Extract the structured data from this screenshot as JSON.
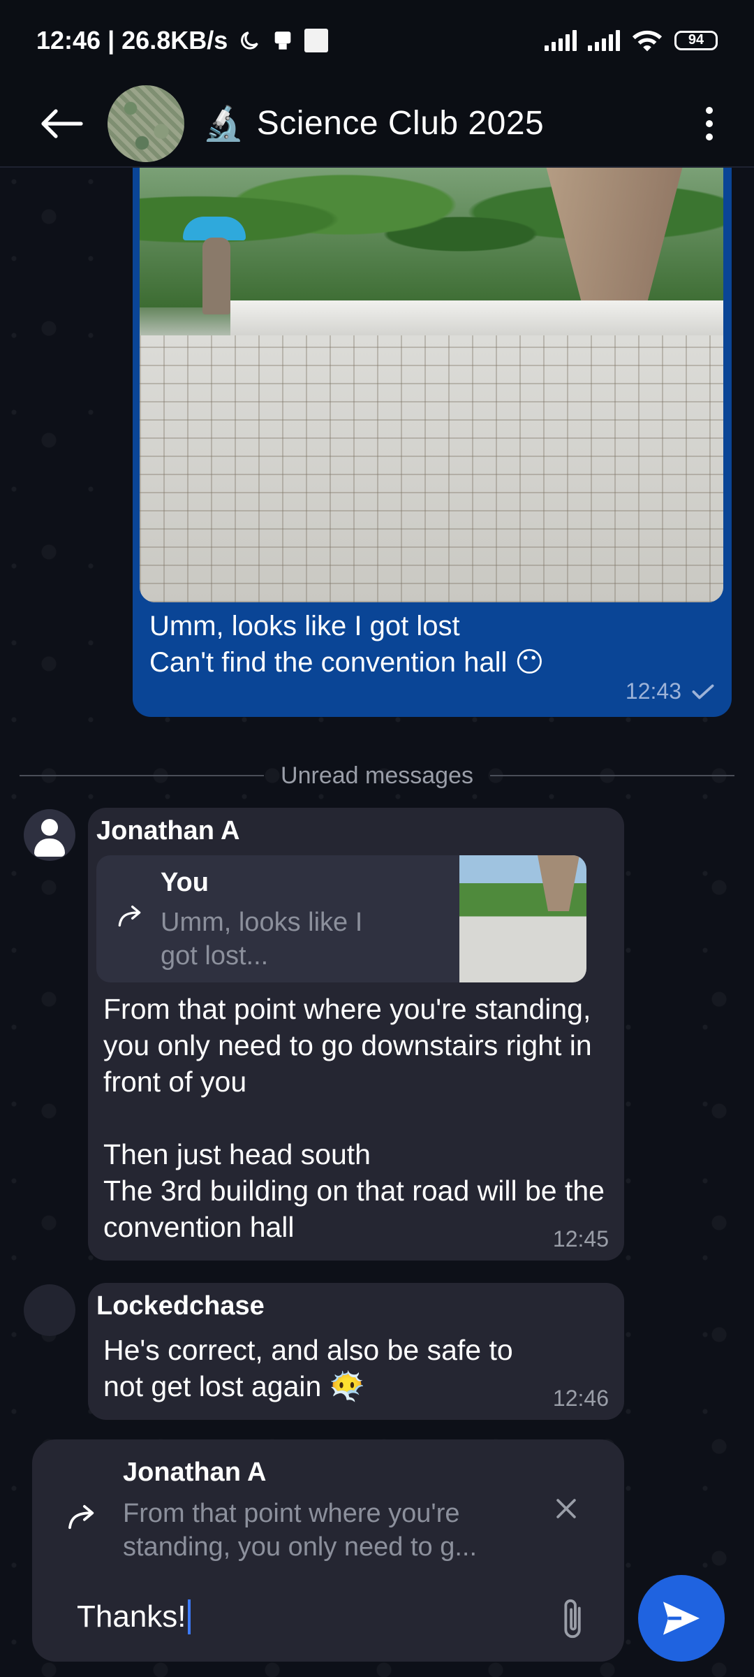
{
  "status_bar": {
    "left_text": "12:46 | 26.8KB/s",
    "battery": "94"
  },
  "header": {
    "group_emoji": "🔬",
    "title": "Science Club 2025"
  },
  "own_message": {
    "lines": [
      "Umm, looks like I got lost",
      "Can't find the convention hall 😶"
    ],
    "time": "12:43"
  },
  "unread_label": "Unread messages",
  "messages": [
    {
      "sender": "Jonathan A",
      "reply": {
        "name": "You",
        "text": "Umm, looks like I got lost..."
      },
      "paragraphs": [
        "From that point where you're standing, you only need to go downstairs right in front of you",
        "Then just head south\nThe 3rd building on that road will be the convention hall"
      ],
      "time": "12:45"
    },
    {
      "sender": "Lockedchase",
      "text": "He's correct, and also be safe to not get lost again 😶‍🌫️",
      "time": "12:46"
    }
  ],
  "composer": {
    "reply_name": "Jonathan A",
    "reply_text": "From that point where you're standing, you only need to g...",
    "input_value": "Thanks!"
  },
  "icons": {
    "back": "back-arrow-icon",
    "menu": "more-vertical-icon",
    "read": "check-icon",
    "reply": "reply-arrow-icon",
    "close": "close-icon",
    "attach": "paperclip-icon",
    "send": "send-icon"
  },
  "colors": {
    "own_bubble": "#0a4596",
    "incoming_bubble": "#252632",
    "send_button": "#1f63e0",
    "background": "#0b0e14"
  }
}
